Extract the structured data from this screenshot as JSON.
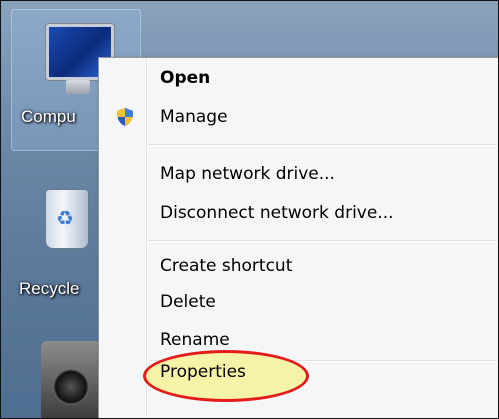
{
  "desktop": {
    "icons": [
      {
        "label": "Compu",
        "icon": "computer-icon"
      },
      {
        "label": "Recycle",
        "icon": "recycle-bin-icon"
      },
      {
        "label": "",
        "icon": "camera-icon"
      }
    ]
  },
  "context_menu": {
    "items": [
      {
        "label": "Open",
        "bold": true
      },
      {
        "label": "Manage",
        "icon": "uac-shield-icon"
      },
      {
        "label": "Map network drive..."
      },
      {
        "label": "Disconnect network drive..."
      },
      {
        "label": "Create shortcut"
      },
      {
        "label": "Delete"
      },
      {
        "label": "Rename"
      },
      {
        "label": "Properties",
        "highlighted": true
      }
    ]
  },
  "colors": {
    "highlight_ring": "#e41b1b",
    "highlight_fill": "#f5f3a8",
    "menu_background": "#f5f6f7"
  }
}
